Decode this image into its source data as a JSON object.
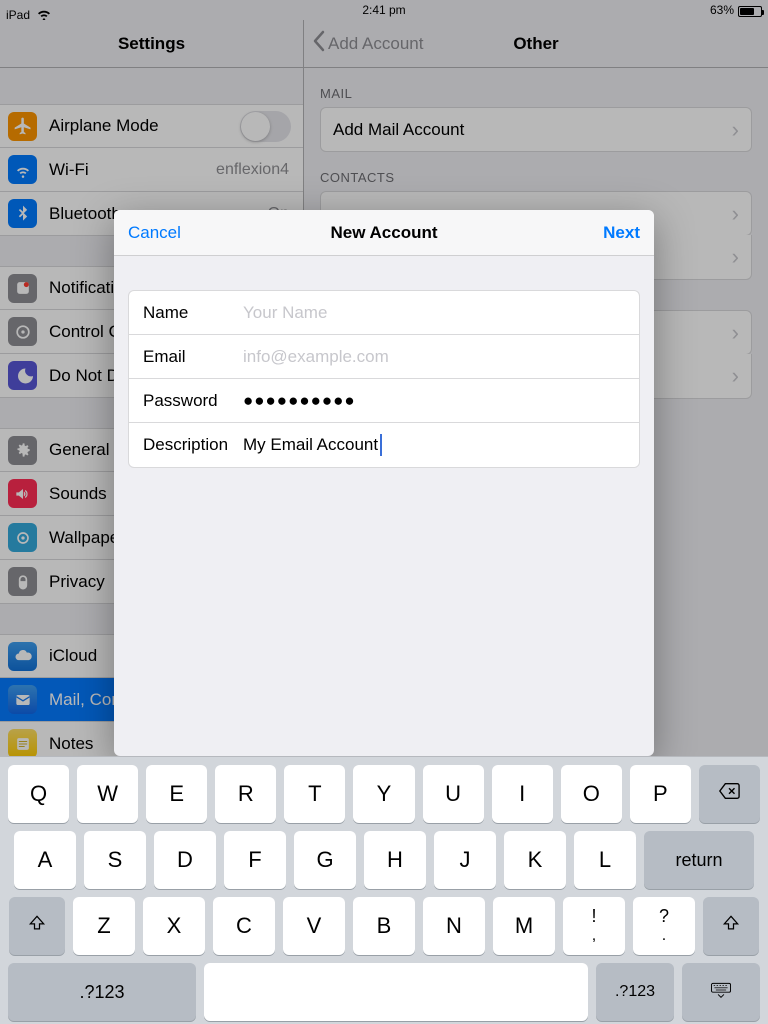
{
  "status": {
    "device": "iPad",
    "time": "2:41 pm",
    "battery_pct": "63%"
  },
  "left": {
    "title": "Settings",
    "airplane": "Airplane Mode",
    "wifi": "Wi-Fi",
    "wifi_value": "enflexion4",
    "bluetooth": "Bluetooth",
    "bluetooth_value": "On",
    "notifications": "Notifications",
    "control_center": "Control Center",
    "dnd": "Do Not Disturb",
    "general": "General",
    "sounds": "Sounds",
    "wallpaper": "Wallpaper",
    "privacy": "Privacy",
    "icloud": "iCloud",
    "mail": "Mail, Contacts, Calendars",
    "notes": "Notes"
  },
  "right": {
    "back": "Add Account",
    "title": "Other",
    "mail_header": "MAIL",
    "add_mail": "Add Mail Account",
    "contacts_header": "CONTACTS"
  },
  "modal": {
    "cancel": "Cancel",
    "title": "New Account",
    "next": "Next",
    "fields": {
      "name_label": "Name",
      "name_ph": "Your Name",
      "email_label": "Email",
      "email_ph": "info@example.com",
      "password_label": "Password",
      "password_value": "●●●●●●●●●●",
      "desc_label": "Description",
      "desc_value": "My Email Account"
    }
  },
  "kbd": {
    "r1": [
      "Q",
      "W",
      "E",
      "R",
      "T",
      "Y",
      "U",
      "I",
      "O",
      "P"
    ],
    "r2": [
      "A",
      "S",
      "D",
      "F",
      "G",
      "H",
      "J",
      "K",
      "L"
    ],
    "r3": [
      "Z",
      "X",
      "C",
      "V",
      "B",
      "N",
      "M"
    ],
    "dual1_top": "!",
    "dual1_bot": ",",
    "dual2_top": "?",
    "dual2_bot": ".",
    "return": "return",
    "sym": ".?123"
  }
}
